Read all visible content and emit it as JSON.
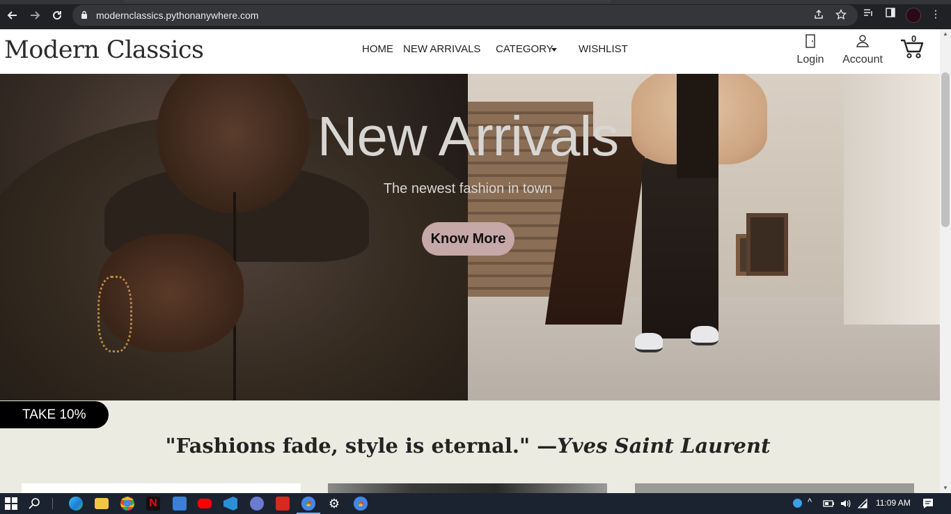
{
  "browser": {
    "url": "modernclassics.pythonanywhere.com",
    "back_glyph": "🡐",
    "forward_glyph": "🡒",
    "reload_glyph": "⟳",
    "menu_glyph": "⋮"
  },
  "header": {
    "brand": "Modern Classics",
    "nav": {
      "home": "HOME",
      "new_arrivals": "NEW ARRIVALS",
      "category": "CATEGORY",
      "wishlist": "WISHLIST"
    },
    "login_label": "Login",
    "account_label": "Account",
    "cart_count": "0"
  },
  "hero": {
    "title": "New Arrivals",
    "subtitle": "The newest fashion in town",
    "button_label": "Know More"
  },
  "promo": {
    "label": "TAKE 10%"
  },
  "quote": {
    "text": "\"Fashions fade, style is eternal.\" —",
    "author": "Yves Saint Laurent"
  },
  "taskbar": {
    "time": "11:09 AM"
  },
  "colors": {
    "page_bg": "#ecebe2",
    "hero_button": "#c6a8a8",
    "browser_dark": "#202124",
    "taskbar": "#1b2330"
  }
}
